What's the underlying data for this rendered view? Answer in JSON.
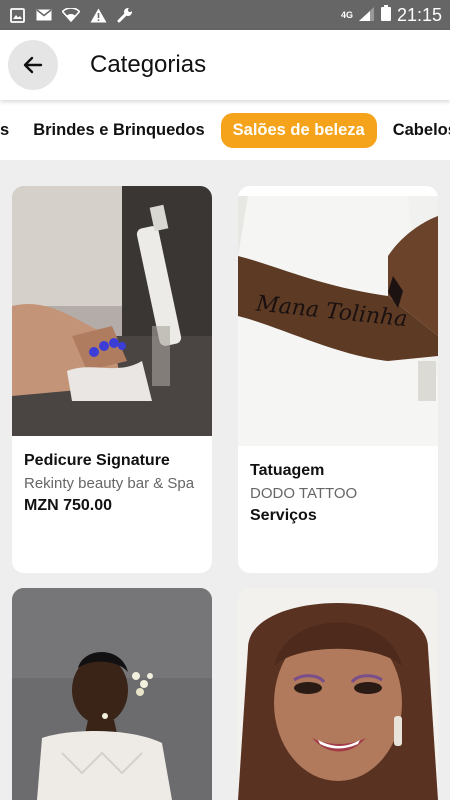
{
  "status_bar": {
    "network": "4G",
    "time": "21:15",
    "left_icons": [
      "image-icon",
      "mail-icon",
      "wifi-icon",
      "warning-icon",
      "wrench-icon"
    ]
  },
  "header": {
    "back_icon": "arrow-left-icon",
    "title": "Categorias"
  },
  "tabs": [
    {
      "label": "s",
      "active": false
    },
    {
      "label": "Brindes e Brinquedos",
      "active": false
    },
    {
      "label": "Salões de beleza",
      "active": true
    },
    {
      "label": "Cabelos",
      "active": false
    }
  ],
  "colors": {
    "accent": "#f5a31a",
    "status_bar": "#666666",
    "background": "#eeeeee"
  },
  "cards": [
    {
      "title": "Pedicure Signature",
      "vendor": "Rekinty beauty bar & Spa",
      "price": "MZN 750.00"
    },
    {
      "title": "Tatuagem",
      "vendor": "DODO TATTOO",
      "price": "Serviços",
      "tattoo_text": "Mana Tolinha"
    },
    {
      "title": "",
      "vendor": "",
      "price": ""
    },
    {
      "title": "",
      "vendor": "",
      "price": ""
    }
  ]
}
